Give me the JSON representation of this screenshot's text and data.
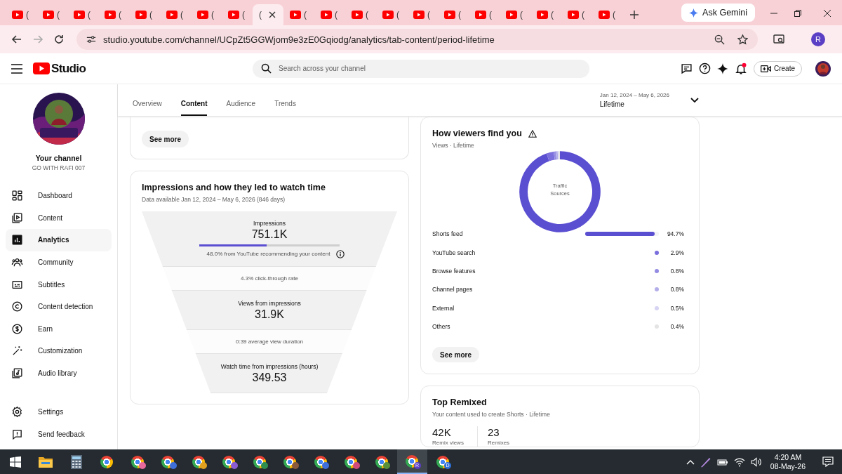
{
  "browser": {
    "tabs": [
      {
        "title": "(",
        "selected": false
      },
      {
        "title": "(",
        "selected": false
      },
      {
        "title": "(",
        "selected": false
      },
      {
        "title": "(",
        "selected": false
      },
      {
        "title": "(",
        "selected": false
      },
      {
        "title": "(",
        "selected": false
      },
      {
        "title": "(",
        "selected": false
      },
      {
        "title": "(",
        "selected": false
      },
      {
        "title": "(",
        "selected": true
      },
      {
        "title": "(",
        "selected": false
      },
      {
        "title": "(",
        "selected": false
      },
      {
        "title": "(",
        "selected": false
      },
      {
        "title": "(",
        "selected": false
      },
      {
        "title": "(",
        "selected": false
      },
      {
        "title": "(",
        "selected": false
      },
      {
        "title": "(",
        "selected": false
      },
      {
        "title": "(",
        "selected": false
      },
      {
        "title": "(",
        "selected": false
      },
      {
        "title": "(",
        "selected": false
      },
      {
        "title": "(",
        "selected": false
      }
    ],
    "gemini_button": "Ask Gemini",
    "url": "studio.youtube.com/channel/UCpZt5GGWjom9e3zE0Gqiodg/analytics/tab-content/period-lifetime",
    "profile_initial": "R"
  },
  "studio": {
    "logo": "Studio",
    "search": {
      "placeholder": "Search across your channel"
    },
    "create_button": "Create"
  },
  "sidebar": {
    "channel_label": "Your channel",
    "channel_name": "GO WITH RAFI 007",
    "items": [
      {
        "label": "Dashboard",
        "selected": false
      },
      {
        "label": "Content",
        "selected": false
      },
      {
        "label": "Analytics",
        "selected": true
      },
      {
        "label": "Community",
        "selected": false
      },
      {
        "label": "Subtitles",
        "selected": false
      },
      {
        "label": "Content detection",
        "selected": false
      },
      {
        "label": "Earn",
        "selected": false
      },
      {
        "label": "Customization",
        "selected": false
      },
      {
        "label": "Audio library",
        "selected": false
      }
    ],
    "footer_items": [
      {
        "label": "Settings"
      },
      {
        "label": "Send feedback"
      }
    ]
  },
  "analytics": {
    "tabs": [
      {
        "label": "Overview",
        "selected": false
      },
      {
        "label": "Content",
        "selected": true
      },
      {
        "label": "Audience",
        "selected": false
      },
      {
        "label": "Trends",
        "selected": false
      }
    ],
    "date_range": "Jan 12, 2024 – May 6, 2026",
    "period": "Lifetime"
  },
  "top_card": {
    "button": "See more"
  },
  "impressions_card": {
    "title": "Impressions and how they led to watch time",
    "subtitle": "Data available Jan 12, 2024 – May 6, 2026 (846 days)",
    "stages": [
      {
        "kind": "metric",
        "label": "Impressions",
        "value": "751.1K",
        "level": 0.48,
        "note": "48.0% from YouTube recommending your content"
      },
      {
        "kind": "rate",
        "label": "4.3% click-through rate"
      },
      {
        "kind": "metric",
        "label": "Views from impressions",
        "value": "31.9K"
      },
      {
        "kind": "rate",
        "label": "0:39 average view duration"
      },
      {
        "kind": "metric",
        "label": "Watch time from impressions (hours)",
        "value": "349.53"
      }
    ]
  },
  "traffic_card": {
    "title": "How viewers find you",
    "subtitle": "Views · Lifetime",
    "chart_data": {
      "type": "donut",
      "title": "Traffic Sources",
      "categories": [
        "Shorts feed",
        "YouTube search",
        "Browse features",
        "Channel pages",
        "External",
        "Others"
      ],
      "values": [
        94.7,
        2.9,
        0.8,
        0.8,
        0.5,
        0.4
      ],
      "value_labels": [
        "94.7%",
        "2.9%",
        "0.8%",
        "0.8%",
        "0.5%",
        "0.4%"
      ]
    },
    "sources": [
      {
        "kind": "bar",
        "level": 0.947,
        "color": "#5a4ed1"
      },
      {
        "kind": "dot",
        "color": "#7a6fdc"
      },
      {
        "kind": "dot",
        "color": "#948ce2"
      },
      {
        "kind": "dot",
        "color": "#b3aeea"
      },
      {
        "kind": "dot",
        "color": "#d6d3f3"
      },
      {
        "kind": "dot",
        "color": "#e4e4e4"
      }
    ],
    "button": "See more"
  },
  "remix_card": {
    "title": "Top Remixed",
    "subtitle": "Your content used to create Shorts · Lifetime",
    "stats": [
      {
        "value": "42K",
        "label": "Remix views"
      },
      {
        "value": "23",
        "label": "Remixes"
      }
    ]
  },
  "taskbar": {
    "apps": [
      {
        "kind": "start",
        "selected": false
      },
      {
        "kind": "folder",
        "selected": false
      },
      {
        "kind": "calculator",
        "selected": false
      },
      {
        "kind": "browser",
        "selected": false
      },
      {
        "kind": "browser",
        "selected": false,
        "color": "#e86a9c"
      },
      {
        "kind": "browser",
        "selected": false,
        "color": "#3f6fd8"
      },
      {
        "kind": "browser",
        "selected": false,
        "color": "#e0a020"
      },
      {
        "kind": "browser",
        "selected": false,
        "color": "#8a5cd0"
      },
      {
        "kind": "browser",
        "selected": false,
        "color": "#2f8f4e"
      },
      {
        "kind": "browser",
        "selected": false,
        "color": "#8a5a3a"
      },
      {
        "kind": "browser",
        "selected": false,
        "color": "#3f6fd8"
      },
      {
        "kind": "browser",
        "selected": false,
        "color": "#d04a7a"
      },
      {
        "kind": "browser",
        "selected": false,
        "color": "#5a8f3a"
      },
      {
        "kind": "browser",
        "selected": true,
        "color": "#5b3fc4",
        "badge": "R"
      },
      {
        "kind": "browser",
        "selected": false,
        "color": "#2f6fd8",
        "badge": "D"
      }
    ],
    "time": "4:20 AM",
    "date": "08-May-26"
  }
}
